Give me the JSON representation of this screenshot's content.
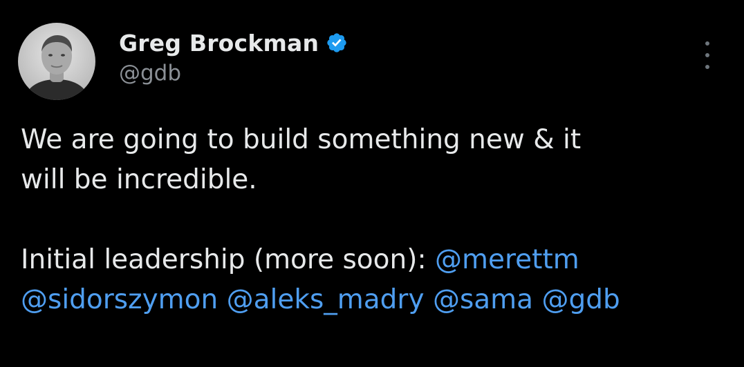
{
  "tweet": {
    "author": {
      "display_name": "Greg Brockman",
      "handle": "@gdb",
      "verified_icon": "verified-badge-icon",
      "avatar_icon": "avatar"
    },
    "more_icon": "more-options-icon",
    "text": {
      "line1": "We are going to build something new & it",
      "line2": "will be incredible.",
      "line3_text": "Initial leadership (more soon): ",
      "mentions": [
        "@merettm",
        "@sidorszymon",
        "@aleks_madry",
        "@sama",
        "@gdb"
      ]
    },
    "colors": {
      "background": "#000000",
      "text": "#e7e9ea",
      "secondary": "#8b9096",
      "link": "#4f9ef0",
      "verified": "#1d9bf0"
    }
  }
}
